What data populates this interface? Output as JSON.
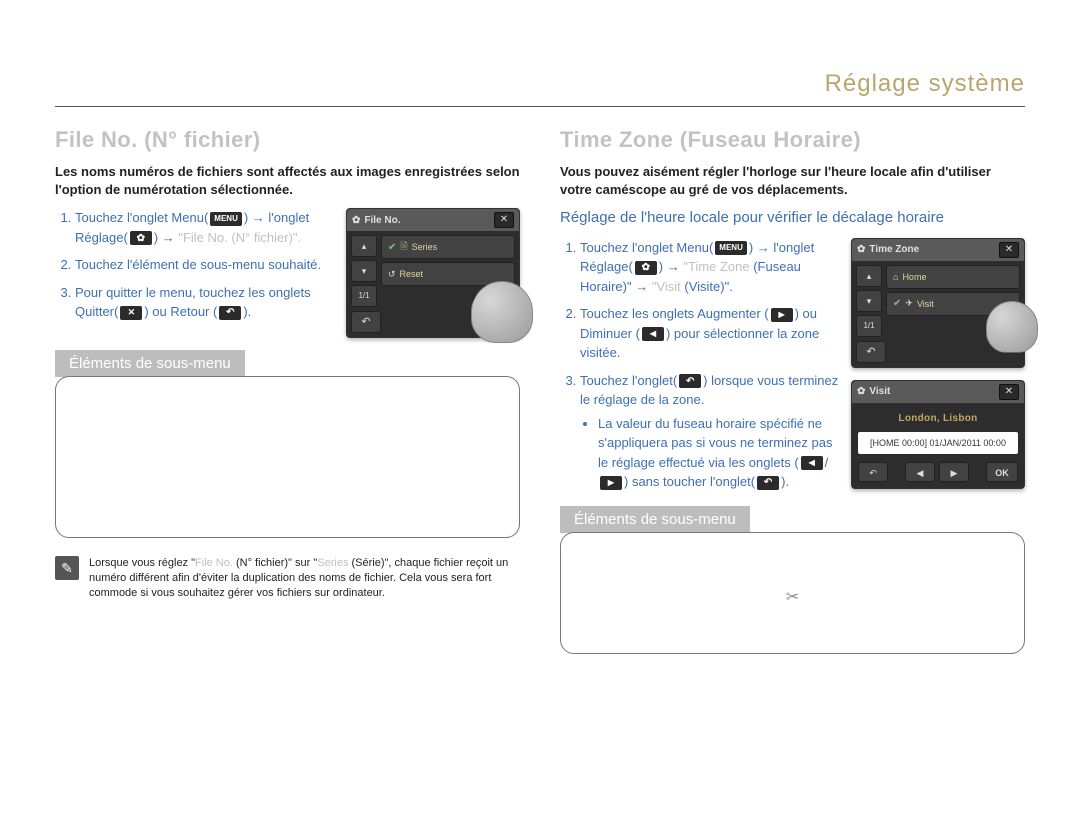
{
  "chapter": "Réglage système",
  "left": {
    "heading": "File No. (N° fichier)",
    "intro": "Les noms numéros de fichiers sont affectés aux images enregistrées selon l'option de numérotation sélectionnée.",
    "step1_a": "Touchez l'onglet Menu",
    "step1_b": "l'onglet Réglage",
    "step1_c": "\"File No. (N° fichier)\".",
    "menu_label": "MENU",
    "step2": "Touchez l'élément de sous-menu souhaité.",
    "step3_a": "Pour quitter le menu, touchez les onglets Quitter(",
    "step3_b": ") ou Retour (",
    "step3_c": ").",
    "subbox_label": "Éléments de sous-menu",
    "note": {
      "a": "Lorsque vous réglez \"",
      "b": "File No.",
      "c": " (N° fichier)\" sur \"",
      "d": "Series",
      "e": " (Série)\", chaque fichier reçoit un numéro différent afin d'éviter la duplication des noms de fichier. Cela vous sera fort commode si vous souhaitez gérer vos fichiers sur ordinateur."
    },
    "screen": {
      "title": "File No.",
      "item1": "Series",
      "item2": "Reset"
    }
  },
  "right": {
    "heading": "Time Zone (Fuseau Horaire)",
    "intro": "Vous pouvez aisément régler l'horloge sur l'heure locale afin d'utiliser votre caméscope au gré de vos déplacements.",
    "subheading": "Réglage de l'heure locale pour vérifier le décalage horaire",
    "menu_label": "MENU",
    "step1_a": "Touchez l'onglet Menu",
    "step1_b": "l'onglet Réglage",
    "step1_c_gray1": "\"Time Zone",
    "step1_c_text": " (Fuseau Horaire)\"",
    "step1_d_gray2": "\"Visit",
    "step1_d_text": " (Visite)\".",
    "step2_a": "Touchez les onglets Augmenter (",
    "step2_b": ") ou Diminuer (",
    "step2_c": ") pour sélectionner la zone visitée.",
    "step3_a": "Touchez l'onglet(",
    "step3_b": ") lorsque vous terminez le réglage de la zone.",
    "bullet_a": "La valeur du fuseau horaire spécifié ne s'appliquera pas si vous ne terminez pas le réglage effectué via les onglets (",
    "bullet_b": ") sans toucher l'onglet(",
    "bullet_c": ").",
    "subbox_label": "Éléments de sous-menu",
    "screen1": {
      "title": "Time Zone",
      "item1": "Home",
      "item2": "Visit"
    },
    "screen2": {
      "title": "Visit",
      "city": "London, Lisbon",
      "info": "[HOME 00:00] 01/JAN/2011 00:00",
      "ok": "OK"
    }
  }
}
